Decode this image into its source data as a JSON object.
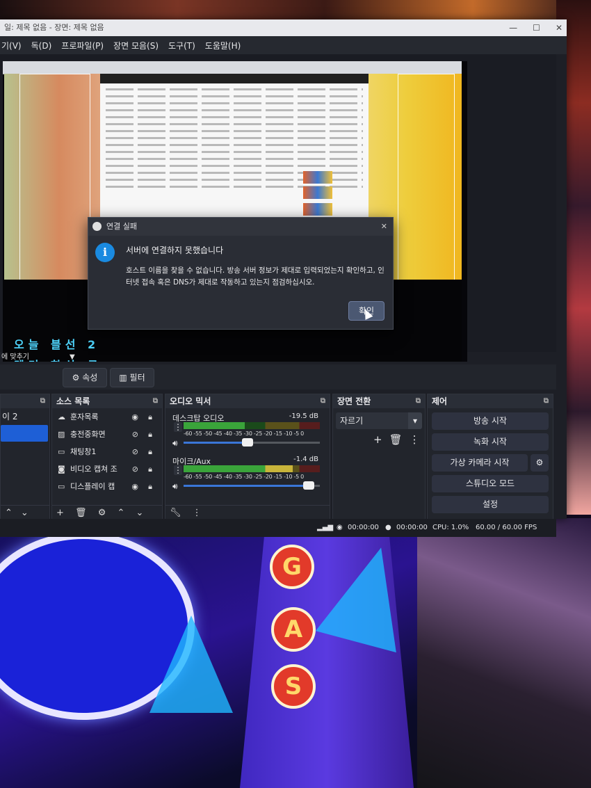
{
  "window": {
    "title": "일: 제목 없음 - 장면: 제목 없음",
    "controls": [
      "—",
      "☐",
      "✕"
    ]
  },
  "menu": [
    "기(V)",
    "독(D)",
    "프로파일(P)",
    "장면 모음(S)",
    "도구(T)",
    "도움말(H)"
  ],
  "preview": {
    "ticker_line1": "오늘 블선 2",
    "ticker_line2": "텐커 향상 금",
    "fit_label": "에 맞추기"
  },
  "toolbar": {
    "properties_label": "속성",
    "filters_label": "필터"
  },
  "scenes_dock": {
    "title": "",
    "items": [
      "이 2"
    ]
  },
  "sources_dock": {
    "title": "소스 목록",
    "items": [
      {
        "label": "훈자목록",
        "icon": "cloud-icon",
        "visible": true
      },
      {
        "label": "충전중화면",
        "icon": "image-icon",
        "visible": false
      },
      {
        "label": "채팅창1",
        "icon": "monitor-icon",
        "visible": false
      },
      {
        "label": "비디오 캡쳐 조",
        "icon": "camera-icon",
        "visible": false
      },
      {
        "label": "디스플레이 캡",
        "icon": "monitor-icon",
        "visible": true
      }
    ]
  },
  "mixer_dock": {
    "title": "오디오 믹서",
    "scale": "-60 -55 -50 -45 -40 -35 -30 -25 -20 -15 -10 -5 0",
    "channels": [
      {
        "name": "데스크탑 오디오",
        "db": "-19.5 dB",
        "level": 0.47
      },
      {
        "name": "마이크/Aux",
        "db": "-1.4 dB",
        "level": 0.92
      }
    ]
  },
  "transition_dock": {
    "title": "장면 전환",
    "selected": "자르기"
  },
  "controls_dock": {
    "title": "제어",
    "buttons": [
      "방송 시작",
      "녹화 시작",
      "가상 카메라 시작",
      "스튜디오 모드",
      "설정"
    ]
  },
  "status": {
    "stream_time": "00:00:00",
    "rec_time": "00:00:00",
    "cpu": "CPU: 1.0%",
    "fps": "60.00 / 60.00 FPS"
  },
  "dialog": {
    "title": "연결 실패",
    "heading": "서버에 연결하지 못했습니다",
    "message": "호스트 이름을 찾을 수 없습니다. 방송 서버 정보가 제대로 입력되었는지 확인하고, 인터넷 접속 혹은 DNS가 제대로 작동하고 있는지 점검하십시오.",
    "ok_label": "확인"
  },
  "background": {
    "label": "배경",
    "sign_letters": [
      "G",
      "A",
      "S"
    ]
  },
  "colors": {
    "accent": "#1a8ae0",
    "selected_scene": "#1e5fd6",
    "ticker": "#4fd6ff"
  }
}
